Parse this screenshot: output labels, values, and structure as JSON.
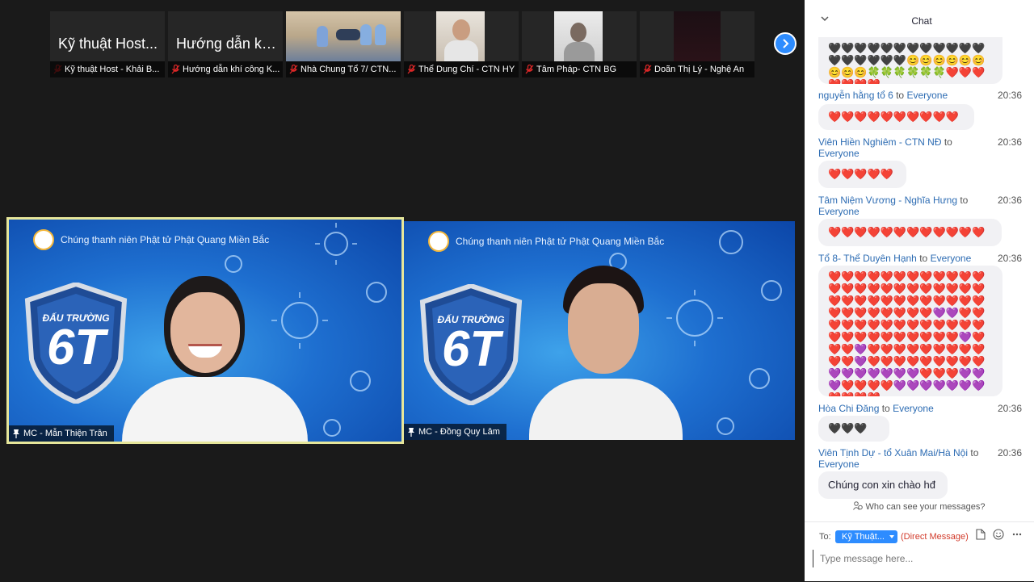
{
  "thumbnails": [
    {
      "big": "Kỹ thuật Host...",
      "label": "Kỹ thuật Host - Khải B..."
    },
    {
      "big": "Hướng dẫn khí...",
      "label": "Hướng dẫn khí công K..."
    },
    {
      "big": "",
      "label": "Nhà Chung Tổ 7/ CTN..."
    },
    {
      "big": "",
      "label": "Thể Dung Chí - CTN HY"
    },
    {
      "big": "",
      "label": "Tâm Pháp- CTN BG"
    },
    {
      "big": "",
      "label": "Doãn Thị Lý - Nghệ An"
    }
  ],
  "tiles": [
    {
      "org": "Chúng thanh niên Phật tử Phật Quang Miền Bắc",
      "banner_top": "ĐẤU TRƯỜNG",
      "banner_big": "6T",
      "name": "MC - Mẫn Thiện Trân"
    },
    {
      "org": "Chúng thanh niên Phật tử Phật Quang Miền Bắc",
      "banner_top": "ĐẤU TRƯỜNG",
      "banner_big": "6T",
      "name": "MC - Đồng Quy Lâm"
    }
  ],
  "chat": {
    "title": "Chat",
    "messages": [
      {
        "sender": "",
        "to": "",
        "recipient": "",
        "time": "",
        "text": "🖤🖤🖤🖤🖤🖤🖤🖤🖤🖤🖤🖤🖤🖤🖤🖤🖤🖤😊😊😊😊😊😊😊😊😊🍀🍀🍀🍀🍀🍀❤️❤️❤️❤️❤️❤️❤️"
      },
      {
        "sender": "nguyễn hằng tổ 6",
        "to": "to",
        "recipient": "Everyone",
        "time": "20:36",
        "text": "❤️❤️❤️❤️❤️❤️❤️❤️❤️❤️"
      },
      {
        "sender": "Viên Hiền Nghiêm - CTN NĐ",
        "to": "to",
        "recipient": "Everyone",
        "time": "20:36",
        "text": "❤️❤️❤️❤️❤️"
      },
      {
        "sender": "Tâm Niệm Vương - Nghĩa Hưng",
        "to": "to",
        "recipient": "Everyone",
        "time": "20:36",
        "text": "❤️❤️❤️❤️❤️❤️❤️❤️❤️❤️❤️❤️"
      },
      {
        "sender": "Tổ 8- Thể Duyên Hạnh",
        "to": "to",
        "recipient": "Everyone",
        "time": "20:36",
        "text": "❤️❤️❤️❤️❤️❤️❤️❤️❤️❤️❤️❤️❤️❤️❤️❤️❤️❤️❤️❤️❤️❤️❤️❤️❤️❤️❤️❤️❤️❤️❤️❤️❤️❤️❤️❤️❤️❤️❤️❤️❤️❤️❤️❤️💜💜❤️❤️❤️❤️❤️❤️❤️❤️❤️❤️❤️❤️❤️❤️❤️❤️❤️❤️❤️❤️❤️❤️❤️❤️💜❤️❤️❤️💜❤️❤️❤️❤️❤️❤️❤️❤️❤️❤️❤️💜❤️❤️❤️❤️❤️❤️❤️❤️❤️💜💜💜💜💜💜💜❤️❤️❤️💜💜💜❤️❤️❤️❤️💜💜💜💜💜💜💜❤️❤️❤️❤️"
      },
      {
        "sender": "Hòa Chi Đăng",
        "to": "to",
        "recipient": "Everyone",
        "time": "20:36",
        "text": "🖤🖤🖤🖤🖤🖤"
      },
      {
        "sender": "Viên Tịnh Dự - tổ Xuân Mai/Hà Nội",
        "to": "to",
        "recipient": "Everyone",
        "time": "20:36",
        "text": "Chúng con xin chào hđ ạ."
      }
    ],
    "privacy": "Who can see your messages?",
    "to_label": "To:",
    "to_value": "Kỹ Thuật...",
    "direct": "(Direct Message)",
    "placeholder": "Type message here..."
  }
}
